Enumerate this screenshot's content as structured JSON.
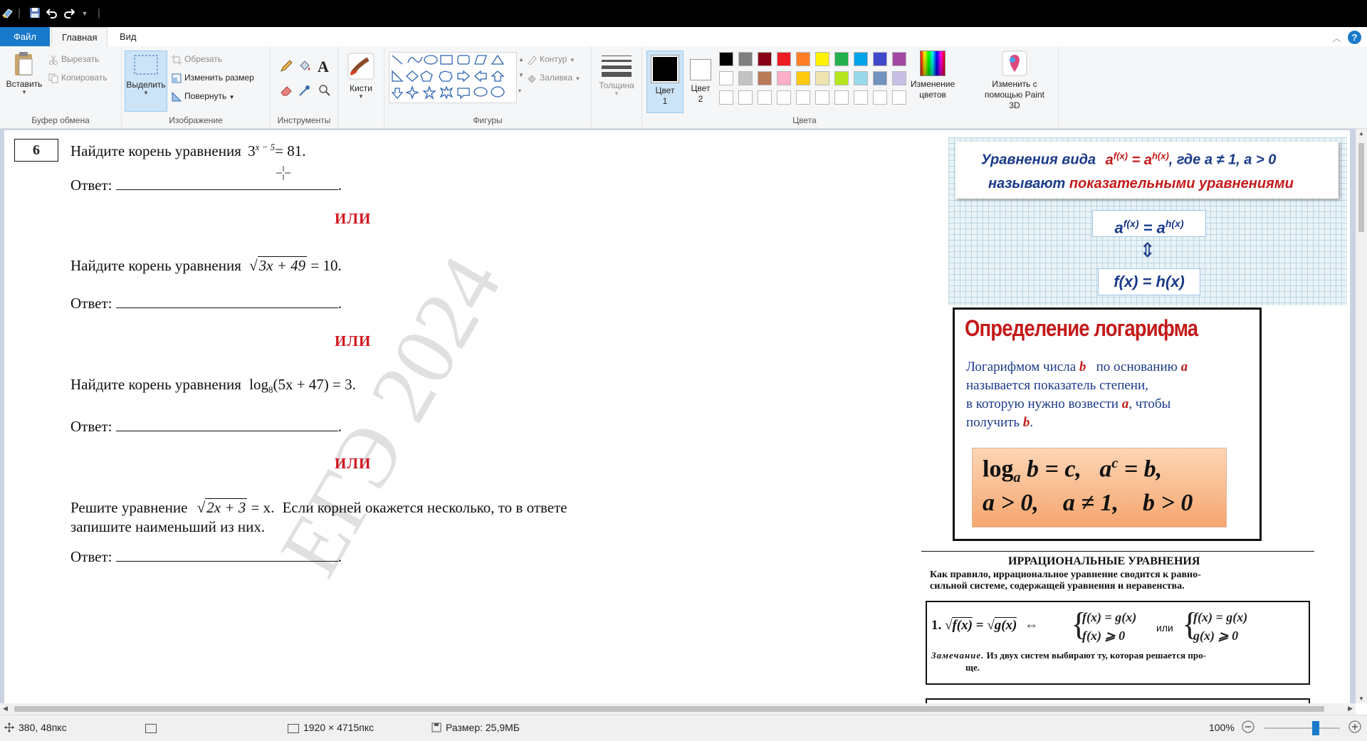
{
  "quick_access": {
    "separator": "|"
  },
  "tabs": [
    {
      "label": "Файл"
    },
    {
      "label": "Главная"
    },
    {
      "label": "Вид"
    }
  ],
  "ribbon": {
    "clipboard": {
      "paste": "Вставить",
      "cut": "Вырезать",
      "copy": "Копировать",
      "group": "Буфер обмена"
    },
    "image": {
      "select": "Выделить",
      "crop": "Обрезать",
      "resize": "Изменить размер",
      "rotate": "Повернуть",
      "group": "Изображение"
    },
    "tools": {
      "group": "Инструменты",
      "text_glyph": "A"
    },
    "brushes": {
      "label": "Кисти"
    },
    "shapes": {
      "outline": "Контур",
      "fill": "Заливка",
      "group": "Фигуры"
    },
    "thickness": {
      "label": "Толщина"
    },
    "color1": {
      "label": "Цвет 1"
    },
    "color2": {
      "label": "Цвет 2"
    },
    "colors": {
      "group": "Цвета",
      "edit": "Изменение цветов"
    },
    "paint3d": {
      "label": "Изменить с помощью Paint 3D"
    },
    "palette_row1": [
      "#000000",
      "#7f7f7f",
      "#880015",
      "#ed1c24",
      "#ff7f27",
      "#fff200",
      "#22b14c",
      "#00a2e8",
      "#3f48cc",
      "#a349a4"
    ],
    "palette_row2": [
      "#ffffff",
      "#c3c3c3",
      "#b97a57",
      "#ffaec9",
      "#ffc90e",
      "#efe4b0",
      "#b5e61d",
      "#99d9ea",
      "#7092be",
      "#c8bfe7"
    ],
    "palette_row3": [
      "#ffffff",
      "#ffffff",
      "#ffffff",
      "#ffffff",
      "#ffffff",
      "#ffffff",
      "#ffffff",
      "#ffffff",
      "#ffffff",
      "#ffffff"
    ]
  },
  "doc": {
    "task_number": "6",
    "q1": {
      "text": "Найдите корень уравнения",
      "formula_base": "3",
      "formula_exp": "x − 5",
      "formula_rhs": "= 81."
    },
    "answer_label": "Ответ:",
    "answer_dot": ".",
    "or": "ИЛИ",
    "q2": {
      "text": "Найдите корень уравнения",
      "radicand": "3x + 49",
      "rhs": "= 10."
    },
    "q3": {
      "text": "Найдите корень уравнения",
      "log": "log",
      "sub": "8",
      "arg": "(5x + 47) = 3."
    },
    "q4": {
      "text1": "Решите уравнение",
      "radicand": "2x + 3",
      "rhs": "= x.",
      "text2": "Если корней окажется несколько, то в ответе",
      "text3": "запишите наименьший из них."
    },
    "watermark": "ЕГЭ 2024"
  },
  "side": {
    "exp_title_1": "Уравнения вида",
    "exp_formula": "a^f(x) = a^h(x)",
    "exp_base": "a",
    "exp_f": "f(x)",
    "exp_h": "h(x)",
    "exp_eq": "=",
    "exp_cond": ", где a ≠ 1, a > 0",
    "exp_title_2": "называют",
    "exp_title_3": "показательными уравнениями",
    "exp_box2": "f(x) = h(x)",
    "exp_arrow": "⇕",
    "log_title": "Определение логарифма",
    "log_p1": "Логарифмом числа",
    "log_b": "b",
    "log_p2": "по основанию",
    "log_a": "a",
    "log_p3": "называется показатель степени,",
    "log_p4": "в которую нужно возвести",
    "log_p4a": "a",
    "log_p4b": ", чтобы",
    "log_p5": "получить",
    "log_p5b": "b",
    "log_p5c": ".",
    "log_f1a": "log",
    "log_f1sub": "a",
    "log_f1b": "b = c,",
    "log_f1c": "a",
    "log_f1sup": "c",
    "log_f1d": "= b,",
    "log_f2": "a > 0,    a ≠ 1,    b > 0",
    "irr_title": "ИРРАЦИОНАЛЬНЫЕ УРАВНЕНИЯ",
    "irr_p1": "Как правило, иррациональное уравнение сводится к равно-",
    "irr_p2": "сильной системе, содержащей уравнения и неравенства.",
    "irr_num": "1.",
    "irr_lhs_f": "f(x)",
    "irr_eq": "=",
    "irr_lhs_g": "g(x)",
    "irr_iff": "⇔",
    "irr_s1a": "f(x) = g(x)",
    "irr_s1b": "f(x) ⩾ 0",
    "irr_or": "или",
    "irr_s2a": "f(x) = g(x)",
    "irr_s2b": "g(x) ⩾ 0",
    "irr_note_label": "Замечание.",
    "irr_note": "Из двух систем выбирают ту, которая решается про-",
    "irr_note2": "ще."
  },
  "status": {
    "cursor": "380, 48пкс",
    "dims": "1920 × 4715пкс",
    "size": "Размер: 25,9МБ",
    "zoom": "100%",
    "zoom_fraction": 0.7
  }
}
